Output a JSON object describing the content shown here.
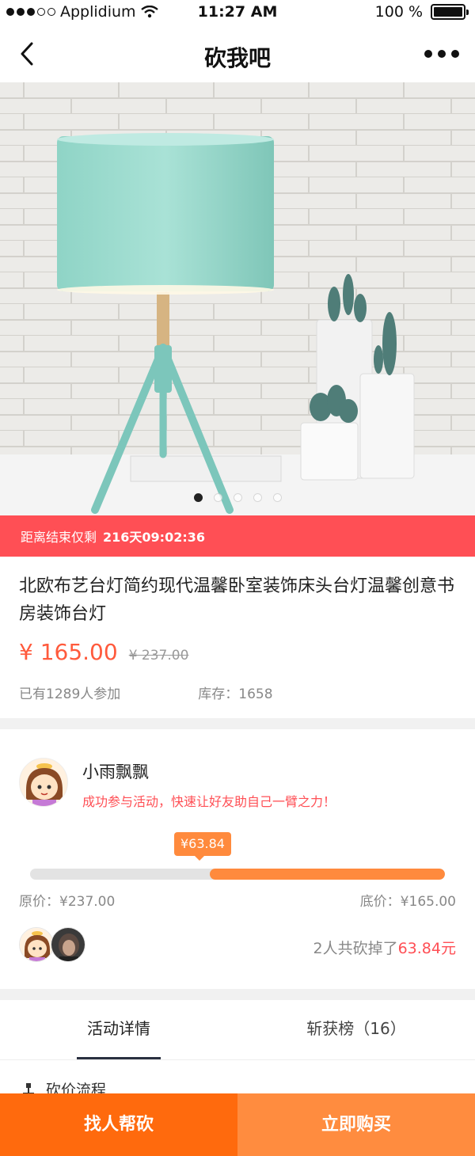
{
  "status_bar": {
    "carrier": "Applidium",
    "time": "11:27 AM",
    "battery": "100 %"
  },
  "nav": {
    "title": "砍我吧",
    "back_icon": "chevron-left-icon",
    "more_icon": "more-dots-icon"
  },
  "hero": {
    "image": "teal-table-lamp-photo",
    "slide_count": 5,
    "active_slide": 1
  },
  "countdown": {
    "label": "距离结束仅剩",
    "time": "216天09:02:36"
  },
  "product": {
    "title": "北欧布艺台灯简约现代温馨卧室装饰床头台灯温馨创意书房装饰台灯",
    "price": "¥ 165.00",
    "original_price": "¥ 237.00",
    "participants": "已有1289人参加",
    "stock": "库存：1658"
  },
  "bargain": {
    "user_name": "小雨飘飘",
    "message": "成功参与活动，快速让好友助自己一臂之力！",
    "cut_amount": "¥63.84",
    "progress_cut_fraction": 0.5667,
    "original_label": "原价：¥237.00",
    "floor_label": "底价：¥165.00",
    "summary_prefix": "2人共砍掉了",
    "summary_amount": "63.84元"
  },
  "tabs": [
    {
      "label": "活动详情",
      "active": true
    },
    {
      "label": "斩获榜（16）",
      "active": false
    }
  ],
  "flow": {
    "heading": "砍价流程"
  },
  "actions": {
    "help_label": "找人帮砍",
    "buy_label": "立即购买"
  },
  "colors": {
    "accent_red": "#ff4f55",
    "accent_orange": "#ff8a3d",
    "help_button": "#ff6a0d",
    "buy_button": "#ff8c3f"
  }
}
